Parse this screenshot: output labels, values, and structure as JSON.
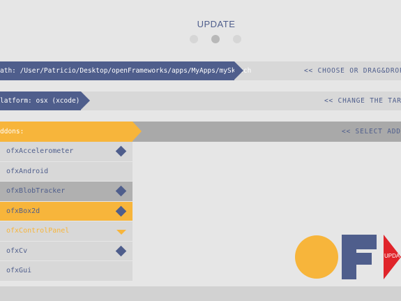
{
  "header": {
    "title": "UPDATE",
    "pages": 3,
    "active_page": 2
  },
  "path": {
    "label": "ath: /User/Patricio/Desktop/openFrameworks/apps/MyApps/mySketch",
    "hint": "<< CHOOSE OR DRAG&DROP"
  },
  "platform": {
    "label": "latform: osx (xcode)",
    "hint": "<< CHANGE THE TARG"
  },
  "addons": {
    "label": "ddons:",
    "hint": "<< SELECT ADDO",
    "items": [
      {
        "label": "ofxAccelerometer",
        "state": "checked"
      },
      {
        "label": "ofxAndroid",
        "state": "none"
      },
      {
        "label": "ofxBlobTracker",
        "state": "selected"
      },
      {
        "label": "ofxBox2d",
        "state": "highlighted"
      },
      {
        "label": "ofxControlPanel",
        "state": "expanded"
      },
      {
        "label": "ofxCv",
        "state": "checked"
      },
      {
        "label": "ofxGui",
        "state": "none"
      }
    ]
  },
  "update_button": {
    "label": "UPDA"
  },
  "colors": {
    "navy": "#4f5e8c",
    "orange": "#f7b53b",
    "red": "#e0242a",
    "background": "#e6e6e6"
  }
}
